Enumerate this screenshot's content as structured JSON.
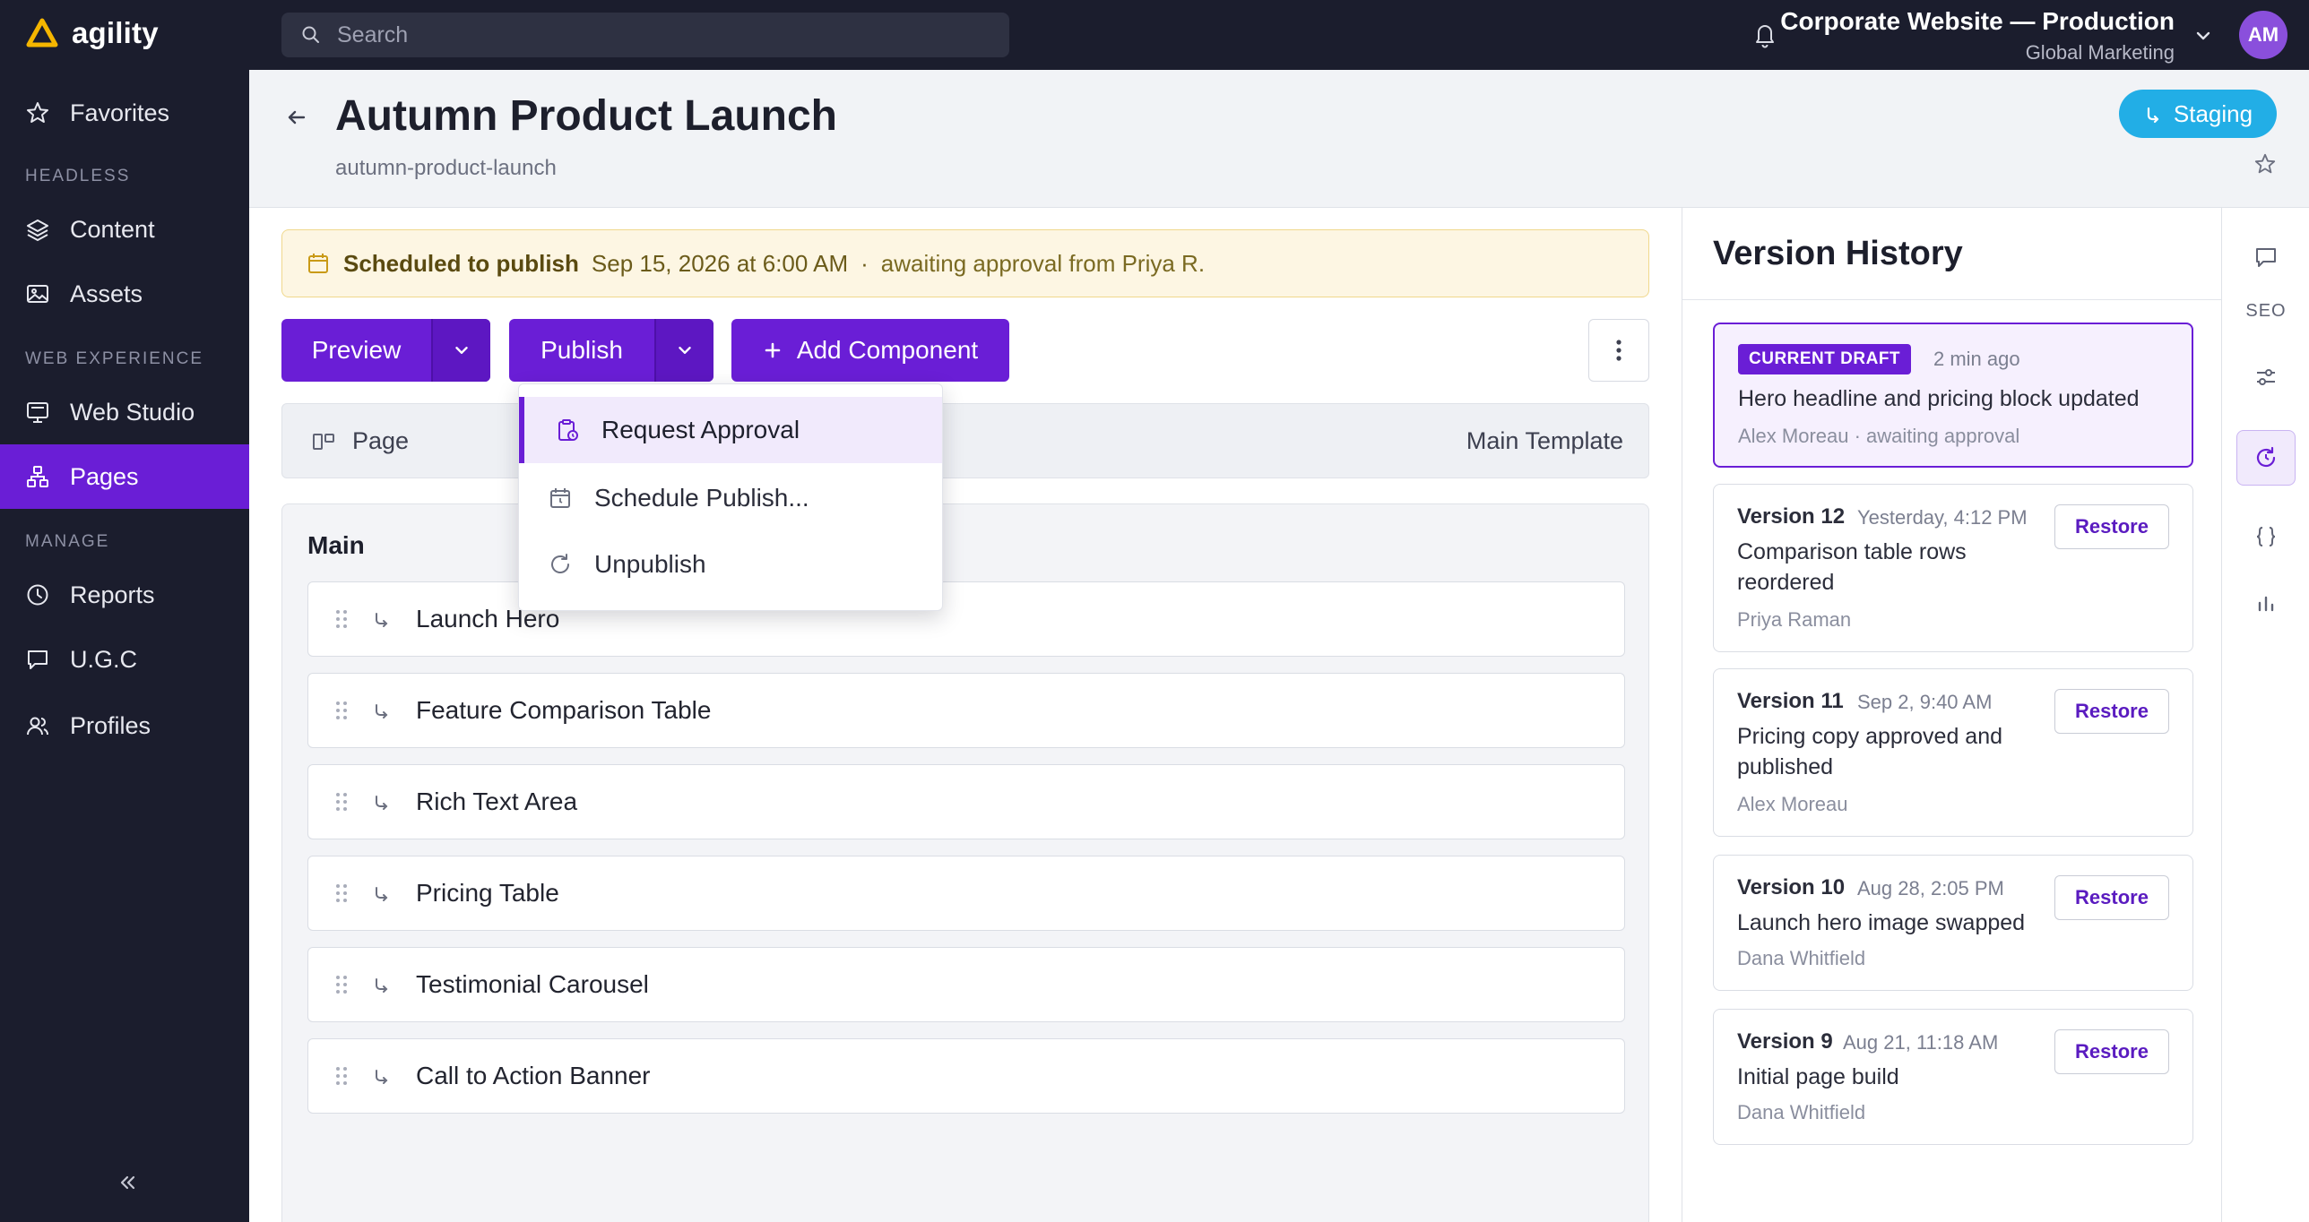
{
  "brand": {
    "name": "agility",
    "accent": "#6a1ed6",
    "logo_color": "#f5b600"
  },
  "topbar": {
    "search_placeholder": "Search",
    "site_title": "Corporate Website — Production",
    "site_subtitle": "Global Marketing",
    "avatar_initials": "AM"
  },
  "sidebar": {
    "favorites": "Favorites",
    "section_headless": "HEADLESS",
    "content": "Content",
    "assets": "Assets",
    "section_web": "WEB EXPERIENCE",
    "web_studio": "Web Studio",
    "pages": "Pages",
    "section_manage": "MANAGE",
    "reports": "Reports",
    "ugc": "U.G.C",
    "profiles": "Profiles"
  },
  "header": {
    "title": "Autumn Product Launch",
    "slug": "autumn-product-launch",
    "env_label": "Staging"
  },
  "banner": {
    "strong": "Scheduled to publish",
    "date": "Sep 15, 2026 at 6:00 AM",
    "separator": "·",
    "approval": "awaiting approval from Priya R."
  },
  "toolbar": {
    "preview": "Preview",
    "publish": "Publish",
    "add_component": "Add Component"
  },
  "page_row": {
    "label": "Page",
    "template": "Main Template"
  },
  "publish_menu": {
    "items": [
      "Request Approval",
      "Schedule Publish...",
      "Unpublish"
    ]
  },
  "zone": {
    "title": "Main",
    "components": [
      "Launch Hero",
      "Feature Comparison Table",
      "Rich Text Area",
      "Pricing Table",
      "Testimonial Carousel",
      "Call to Action Banner"
    ]
  },
  "version_history": {
    "title": "Version History",
    "restore_label": "Restore",
    "current": {
      "badge": "CURRENT DRAFT",
      "time": "2 min ago",
      "desc": "Hero headline and pricing block updated",
      "meta": "Alex Moreau · awaiting approval"
    },
    "versions": [
      {
        "name": "Version 12",
        "time": "Yesterday, 4:12 PM",
        "desc": "Comparison table rows reordered",
        "author": "Priya Raman"
      },
      {
        "name": "Version 11",
        "time": "Sep 2, 9:40 AM",
        "desc": "Pricing copy approved and published",
        "author": "Alex Moreau"
      },
      {
        "name": "Version 10",
        "time": "Aug 28, 2:05 PM",
        "desc": "Launch hero image swapped",
        "author": "Dana Whitfield"
      },
      {
        "name": "Version 9",
        "time": "Aug 21, 11:18 AM",
        "desc": "Initial page build",
        "author": "Dana Whitfield"
      }
    ]
  },
  "rail": {
    "seo": "SEO"
  }
}
